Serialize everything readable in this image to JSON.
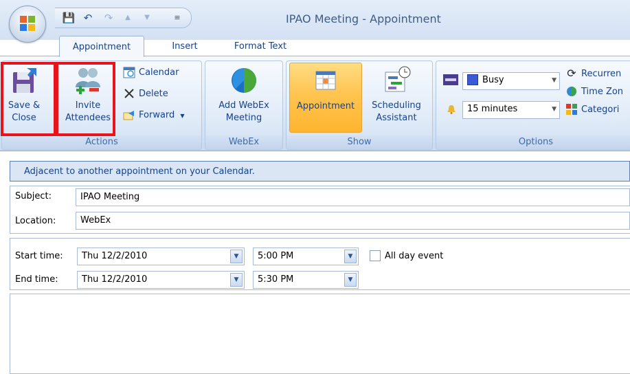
{
  "window": {
    "title": "IPAO Meeting - Appointment"
  },
  "quick_access": {
    "save_glyph": "💾",
    "undo_glyph": "↶",
    "redo_glyph": "↷",
    "up_glyph": "▲",
    "down_glyph": "▼",
    "more_glyph": "≡"
  },
  "tabs": [
    {
      "label": "Appointment",
      "active": true
    },
    {
      "label": "Insert"
    },
    {
      "label": "Format Text"
    }
  ],
  "ribbon": {
    "actions": {
      "label": "Actions",
      "save_close": "Save &\nClose",
      "save_close_line1": "Save &",
      "save_close_line2": "Close",
      "invite_line1": "Invite",
      "invite_line2": "Attendees",
      "calendar": "Calendar",
      "delete": "Delete",
      "forward": "Forward"
    },
    "webex": {
      "label": "WebEx",
      "line1": "Add WebEx",
      "line2": "Meeting"
    },
    "show": {
      "label": "Show",
      "appointment": "Appointment",
      "scheduling_line1": "Scheduling",
      "scheduling_line2": "Assistant"
    },
    "options": {
      "label": "Options",
      "show_as_value": "Busy",
      "reminder_value": "15 minutes",
      "recurrence": "Recurren",
      "time_zones": "Time Zon",
      "categorize": "Categori"
    }
  },
  "info_bar": {
    "text": "Adjacent to another appointment on your Calendar."
  },
  "form": {
    "subject_label": "Subject:",
    "subject_value": "IPAO Meeting",
    "location_label": "Location:",
    "location_value": "WebEx",
    "start_label": "Start time:",
    "start_date": "Thu 12/2/2010",
    "start_time": "5:00 PM",
    "end_label": "End time:",
    "end_date": "Thu 12/2/2010",
    "end_time": "5:30 PM",
    "all_day_label": "All day event",
    "all_day_checked": false
  },
  "colors": {
    "highlight": "#e8141c",
    "busy": "#3b5bd6",
    "active_tab": "#f4f8fd"
  }
}
